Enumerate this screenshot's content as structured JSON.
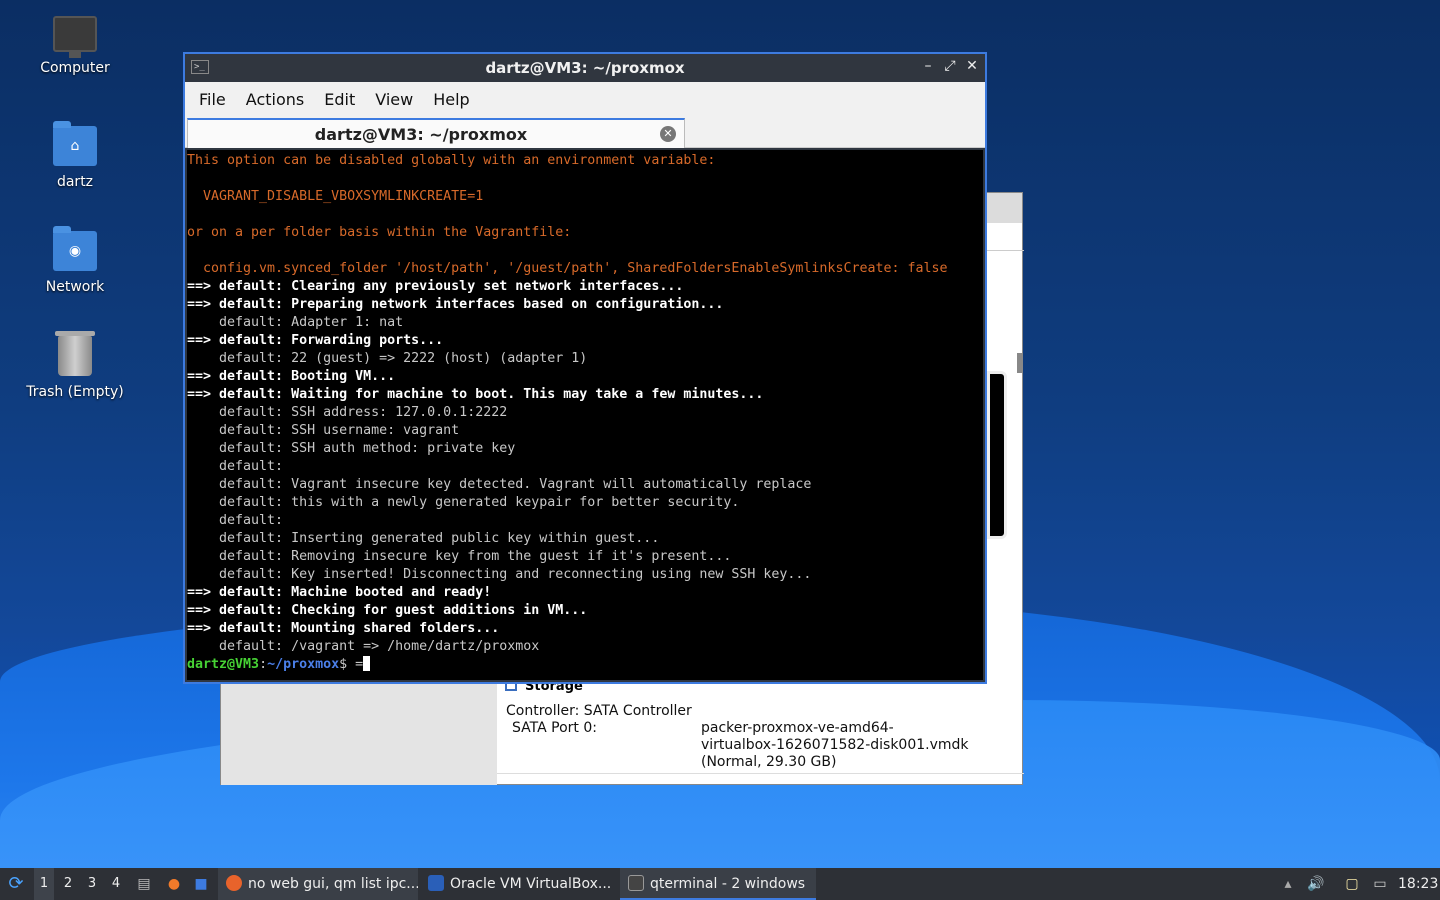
{
  "desktop": {
    "icons": [
      {
        "label": "Computer",
        "icon": "computer-icon"
      },
      {
        "label": "dartz",
        "icon": "home-folder-icon"
      },
      {
        "label": "Network",
        "icon": "network-folder-icon"
      },
      {
        "label": "Trash (Empty)",
        "icon": "trash-icon"
      }
    ]
  },
  "virtualbox": {
    "storage_header": "Storage",
    "controller": "Controller: SATA Controller",
    "port_label": "SATA Port 0:",
    "disk_lines": [
      "packer-proxmox-ve-amd64-",
      "virtualbox-1626071582-disk001.vmdk",
      "(Normal, 29.30 GB)"
    ]
  },
  "terminal": {
    "title": "dartz@VM3: ~/proxmox",
    "controls": {
      "minimize": "–",
      "maximize": "⤢",
      "close": "✕"
    },
    "menu": [
      "File",
      "Actions",
      "Edit",
      "View",
      "Help"
    ],
    "tab_label": "dartz@VM3: ~/proxmox",
    "lines": [
      {
        "text": "This option can be disabled globally with an environment variable:",
        "style": "orange"
      },
      {
        "text": "",
        "style": "normal"
      },
      {
        "text": "  VAGRANT_DISABLE_VBOXSYMLINKCREATE=1",
        "style": "orange"
      },
      {
        "text": "",
        "style": "normal"
      },
      {
        "text": "or on a per folder basis within the Vagrantfile:",
        "style": "orange"
      },
      {
        "text": "",
        "style": "normal"
      },
      {
        "text": "  config.vm.synced_folder '/host/path', '/guest/path', SharedFoldersEnableSymlinksCreate: false",
        "style": "orange"
      },
      {
        "text": "==> default: Clearing any previously set network interfaces...",
        "style": "bold"
      },
      {
        "text": "==> default: Preparing network interfaces based on configuration...",
        "style": "bold"
      },
      {
        "text": "    default: Adapter 1: nat",
        "style": "normal"
      },
      {
        "text": "==> default: Forwarding ports...",
        "style": "bold"
      },
      {
        "text": "    default: 22 (guest) => 2222 (host) (adapter 1)",
        "style": "normal"
      },
      {
        "text": "==> default: Booting VM...",
        "style": "bold"
      },
      {
        "text": "==> default: Waiting for machine to boot. This may take a few minutes...",
        "style": "bold"
      },
      {
        "text": "    default: SSH address: 127.0.0.1:2222",
        "style": "normal"
      },
      {
        "text": "    default: SSH username: vagrant",
        "style": "normal"
      },
      {
        "text": "    default: SSH auth method: private key",
        "style": "normal"
      },
      {
        "text": "    default:",
        "style": "normal"
      },
      {
        "text": "    default: Vagrant insecure key detected. Vagrant will automatically replace",
        "style": "normal"
      },
      {
        "text": "    default: this with a newly generated keypair for better security.",
        "style": "normal"
      },
      {
        "text": "    default:",
        "style": "normal"
      },
      {
        "text": "    default: Inserting generated public key within guest...",
        "style": "normal"
      },
      {
        "text": "    default: Removing insecure key from the guest if it's present...",
        "style": "normal"
      },
      {
        "text": "    default: Key inserted! Disconnecting and reconnecting using new SSH key...",
        "style": "normal"
      },
      {
        "text": "==> default: Machine booted and ready!",
        "style": "bold"
      },
      {
        "text": "==> default: Checking for guest additions in VM...",
        "style": "bold"
      },
      {
        "text": "==> default: Mounting shared folders...",
        "style": "bold"
      },
      {
        "text": "    default: /vagrant => /home/dartz/proxmox",
        "style": "normal"
      }
    ],
    "prompt": {
      "user_host": "dartz@VM3",
      "sep": ":",
      "path": "~/proxmox",
      "suffix": "$ ",
      "input": "="
    }
  },
  "taskbar": {
    "workspaces": [
      "1",
      "2",
      "3",
      "4"
    ],
    "active_workspace": "1",
    "tasks": [
      {
        "label": "no web gui, qm list ipc...",
        "icon": "firefox-icon",
        "color": "#e8632b"
      },
      {
        "label": "Oracle VM VirtualBox...",
        "icon": "virtualbox-icon",
        "color": "#2a5fb8"
      },
      {
        "label": "qterminal - 2 windows",
        "icon": "terminal-icon",
        "color": "#444444"
      }
    ],
    "clock": "18:23"
  }
}
